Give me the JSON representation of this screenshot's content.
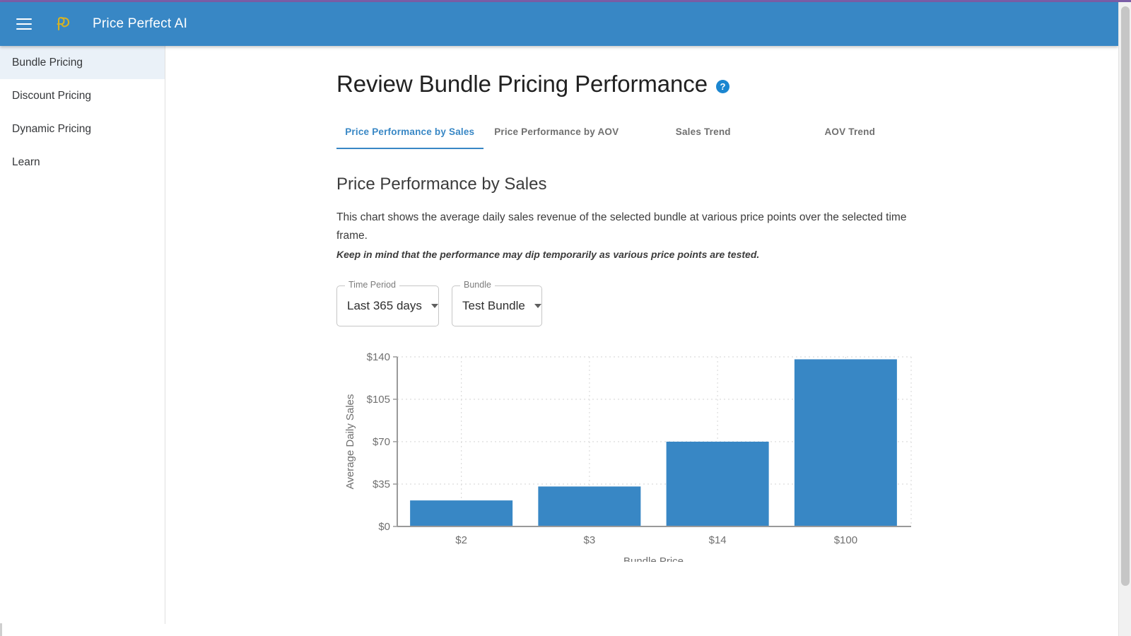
{
  "appbar": {
    "menu_icon": "hamburger-menu-icon",
    "logo_icon": "price-perfect-logo-icon",
    "title": "Price Perfect AI",
    "background_color": "#3887c5"
  },
  "sidebar": {
    "items": [
      {
        "label": "Bundle Pricing",
        "active": true
      },
      {
        "label": "Discount Pricing",
        "active": false
      },
      {
        "label": "Dynamic Pricing",
        "active": false
      },
      {
        "label": "Learn",
        "active": false
      }
    ],
    "active_background_color": "#eaf1f8"
  },
  "main": {
    "page_title": "Review Bundle Pricing Performance",
    "help_icon": "help-circle-icon",
    "help_icon_color": "#1b86d0",
    "tabs": [
      {
        "label": "Price Performance by Sales",
        "active": true
      },
      {
        "label": "Price Performance by AOV",
        "active": false
      },
      {
        "label": "Sales Trend",
        "active": false
      },
      {
        "label": "AOV Trend",
        "active": false
      }
    ],
    "active_tab_color": "#3887c5",
    "section_heading": "Price Performance by Sales",
    "description": "This chart shows the average daily sales revenue of the selected bundle at various price points over the selected time frame.",
    "note": "Keep in mind that the performance may dip temporarily as various price points are tested.",
    "filters": [
      {
        "label": "Time Period",
        "value": "Last 365 days",
        "caret_icon": "chevron-down-icon",
        "width": 145
      },
      {
        "label": "Bundle",
        "value": "Test Bundle",
        "caret_icon": "chevron-down-icon",
        "width": 128
      }
    ]
  },
  "chart_data": {
    "type": "bar",
    "title": "",
    "categories": [
      "$2",
      "$3",
      "$14",
      "$100"
    ],
    "values": [
      21.5,
      33,
      70,
      138
    ],
    "xlabel": "Bundle Price",
    "ylabel": "Average Daily Sales",
    "ylim": [
      0,
      140
    ],
    "yticks": [
      0,
      35,
      70,
      105,
      140
    ],
    "ytick_labels": [
      "$0",
      "$35",
      "$70",
      "$105",
      "$140"
    ],
    "xtick_labels": [
      "$2",
      "$3",
      "$14",
      "$100"
    ],
    "bar_color": "#3887c5",
    "grid": true,
    "grid_style": "dashed",
    "grid_color": "#dcdcdc",
    "axis_color": "#9a9a9a",
    "legend": "none"
  }
}
